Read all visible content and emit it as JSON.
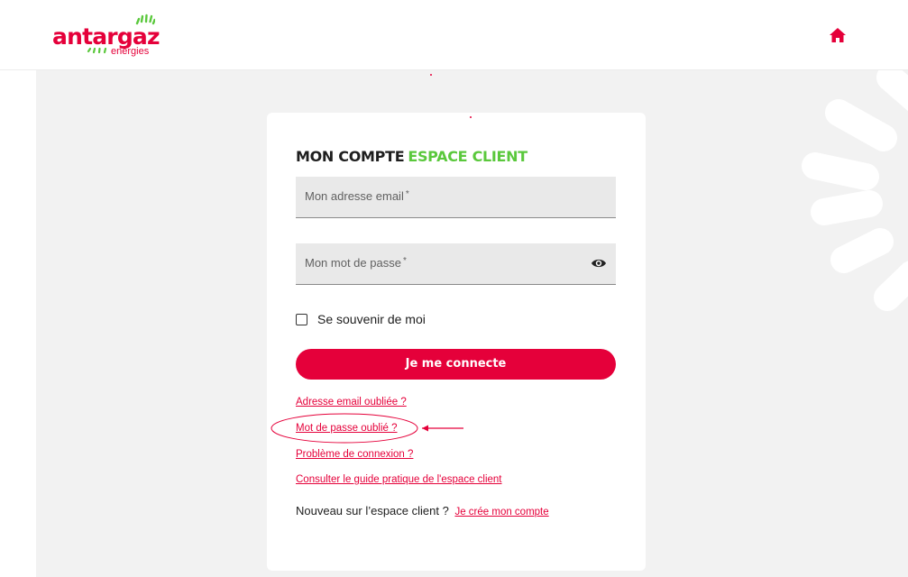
{
  "header": {
    "logo": {
      "brand": "antargaz",
      "sub": "energies"
    },
    "home_icon": "home-icon"
  },
  "card": {
    "title_main": "MON COMPTE",
    "title_accent": "ESPACE CLIENT",
    "email": {
      "label": "Mon adresse email",
      "required_mark": "*",
      "value": ""
    },
    "password": {
      "label": "Mon mot de passe",
      "required_mark": "*",
      "value": "",
      "toggle_icon": "eye-icon"
    },
    "remember": {
      "label": "Se souvenir de moi",
      "checked": false
    },
    "login_button": "Je me connecte",
    "links": {
      "forgot_email": "Adresse email oubliée ?",
      "forgot_password": "Mot de passe oublié ?",
      "login_problem": "Problème de connexion ?",
      "guide": "Consulter le guide pratique de l'espace client"
    },
    "new_user": {
      "text": "Nouveau sur l’espace client ?",
      "link": "Je crée mon compte"
    }
  },
  "colors": {
    "brand_red": "#e5003a",
    "brand_green": "#5ac83c",
    "background": "#f2f2f2",
    "card": "#ffffff",
    "field": "#e9e9e9"
  }
}
